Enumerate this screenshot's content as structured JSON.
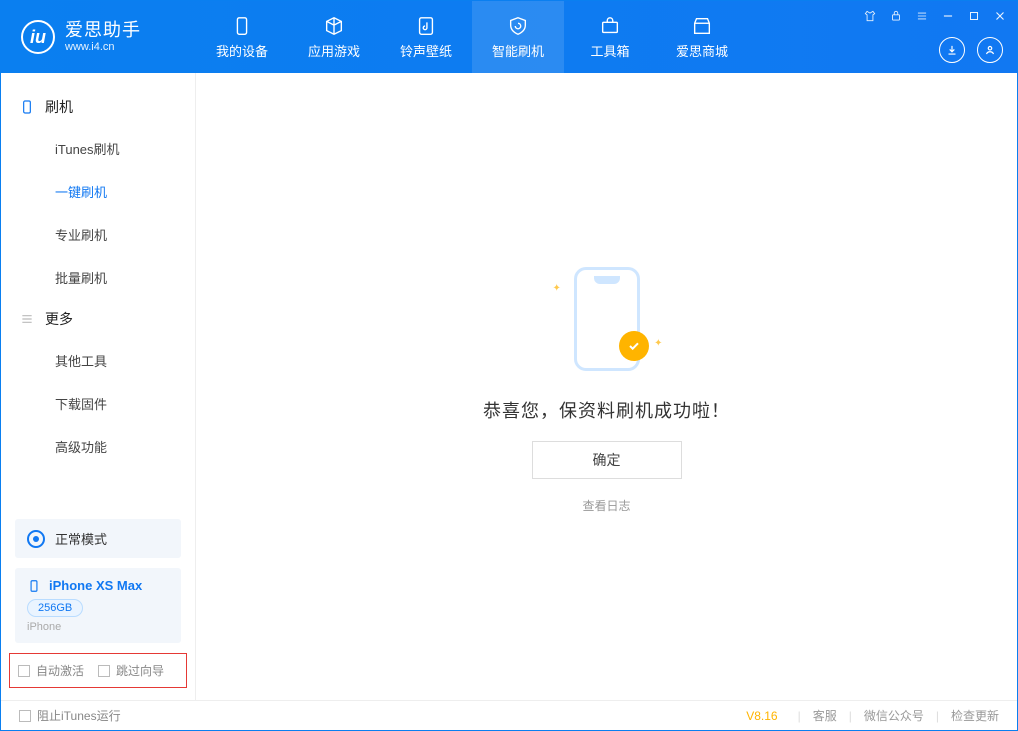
{
  "app": {
    "name_cn": "爱思助手",
    "name_en": "www.i4.cn"
  },
  "tabs": [
    {
      "label": "我的设备"
    },
    {
      "label": "应用游戏"
    },
    {
      "label": "铃声壁纸"
    },
    {
      "label": "智能刷机"
    },
    {
      "label": "工具箱"
    },
    {
      "label": "爱思商城"
    }
  ],
  "sidebar": {
    "section1": {
      "title": "刷机",
      "items": [
        {
          "label": "iTunes刷机"
        },
        {
          "label": "一键刷机"
        },
        {
          "label": "专业刷机"
        },
        {
          "label": "批量刷机"
        }
      ]
    },
    "section2": {
      "title": "更多",
      "items": [
        {
          "label": "其他工具"
        },
        {
          "label": "下载固件"
        },
        {
          "label": "高级功能"
        }
      ]
    },
    "mode": "正常模式",
    "device": {
      "name": "iPhone XS Max",
      "storage": "256GB",
      "type": "iPhone"
    },
    "checks": {
      "auto_activate": "自动激活",
      "skip_guide": "跳过向导"
    }
  },
  "main": {
    "message": "恭喜您，保资料刷机成功啦！",
    "ok": "确定",
    "log_link": "查看日志"
  },
  "footer": {
    "block_itunes": "阻止iTunes运行",
    "version": "V8.16",
    "support": "客服",
    "wechat": "微信公众号",
    "update": "检查更新"
  }
}
